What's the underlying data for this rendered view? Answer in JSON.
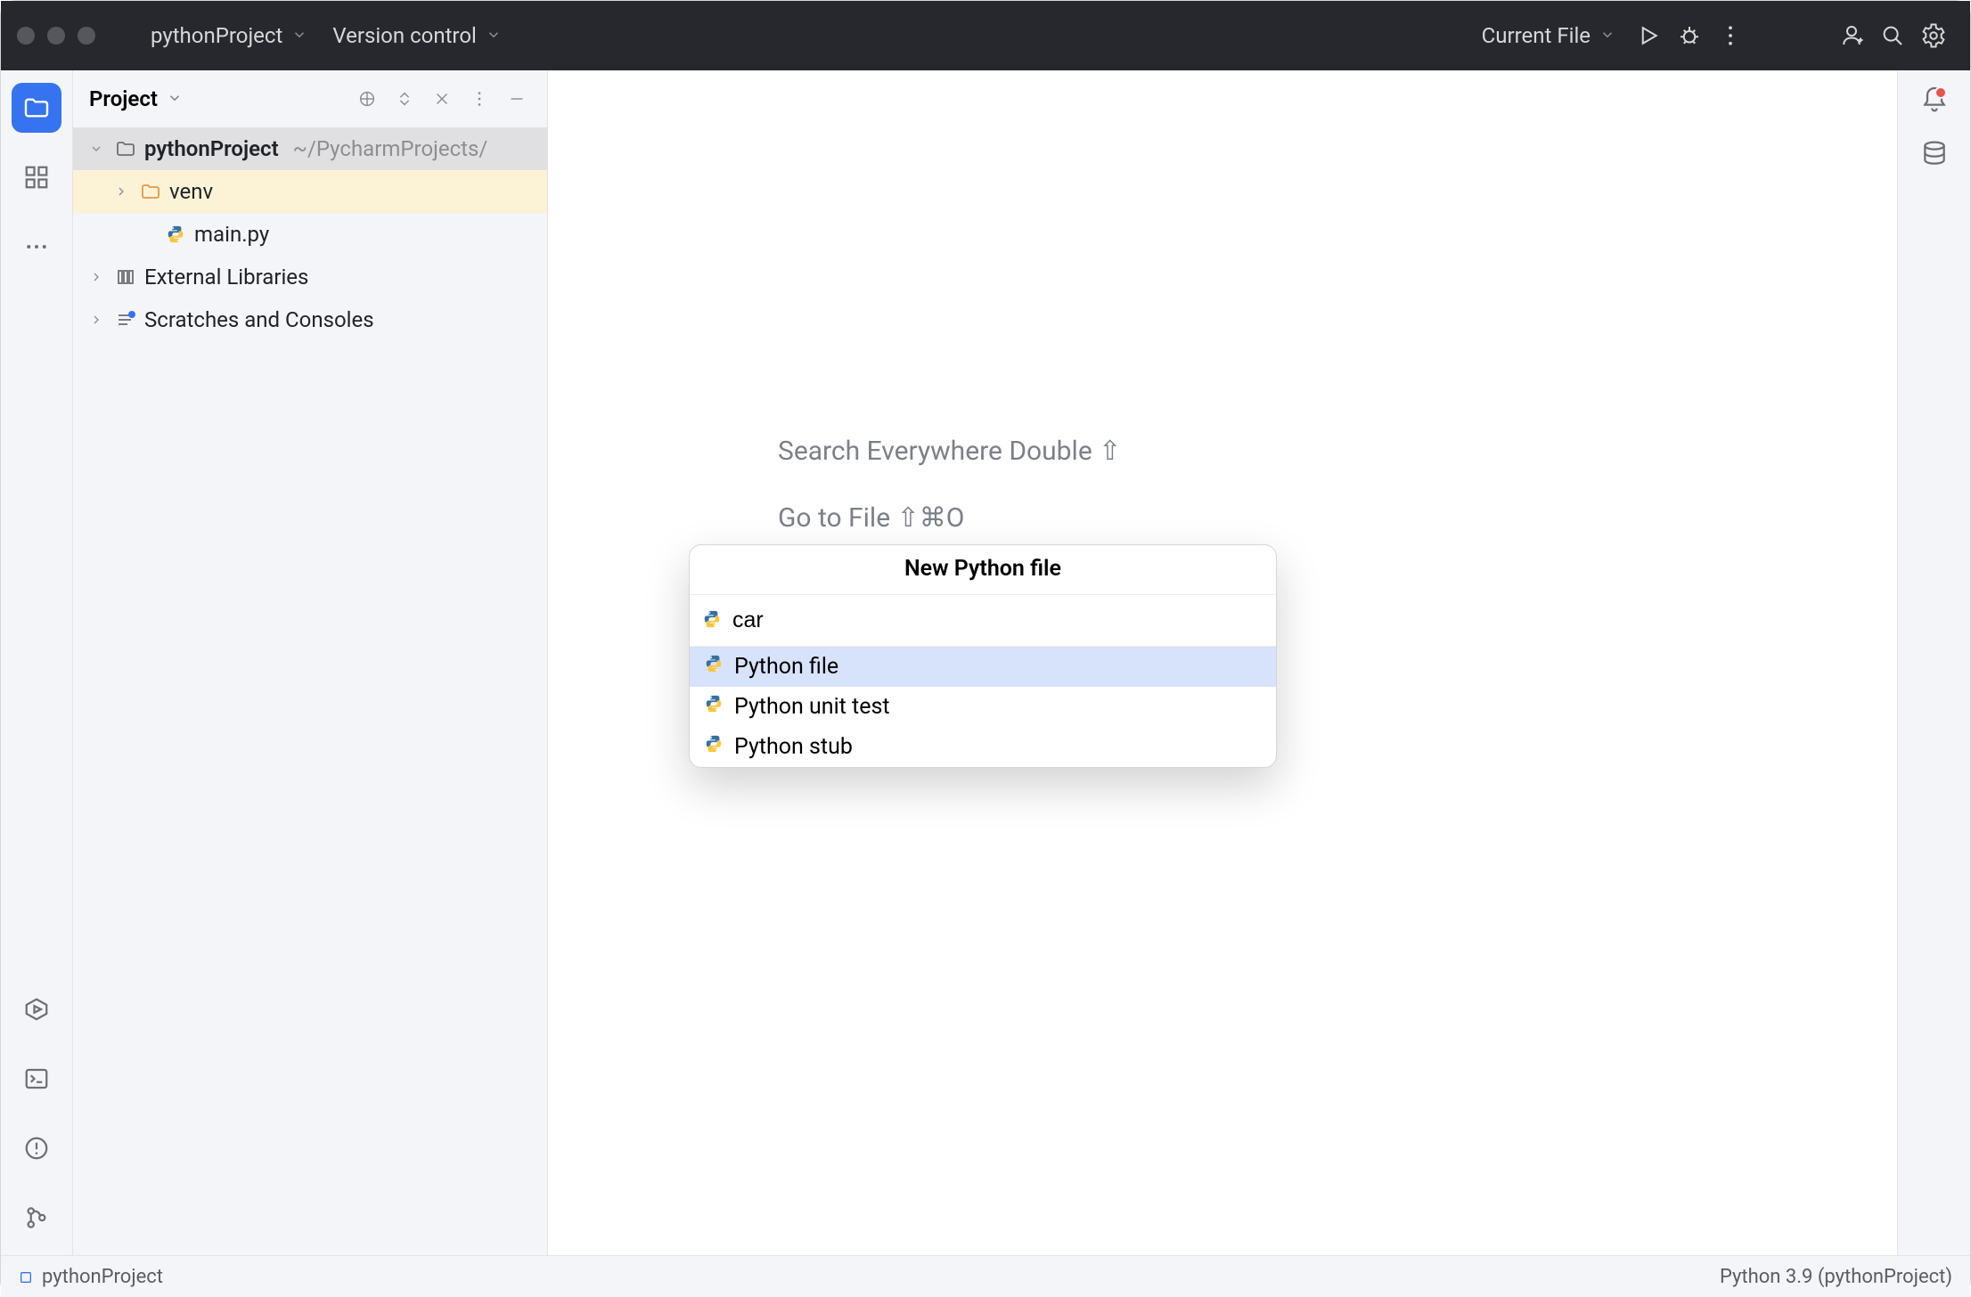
{
  "titlebar": {
    "project_label": "pythonProject",
    "vcs_label": "Version control",
    "run_config": "Current File"
  },
  "project_panel": {
    "title": "Project",
    "root_name": "pythonProject",
    "root_path": "~/PycharmProjects/",
    "venv": "venv",
    "mainpy": "main.py",
    "ext_lib": "External Libraries",
    "scratches": "Scratches and Consoles"
  },
  "hints": {
    "search": "Search Everywhere Double ⇧",
    "goto": "Go to File ⇧⌘O"
  },
  "popup": {
    "title": "New Python file",
    "input_value": "car",
    "options": [
      "Python file",
      "Python unit test",
      "Python stub"
    ]
  },
  "statusbar": {
    "module": "pythonProject",
    "interpreter": "Python 3.9 (pythonProject)"
  }
}
